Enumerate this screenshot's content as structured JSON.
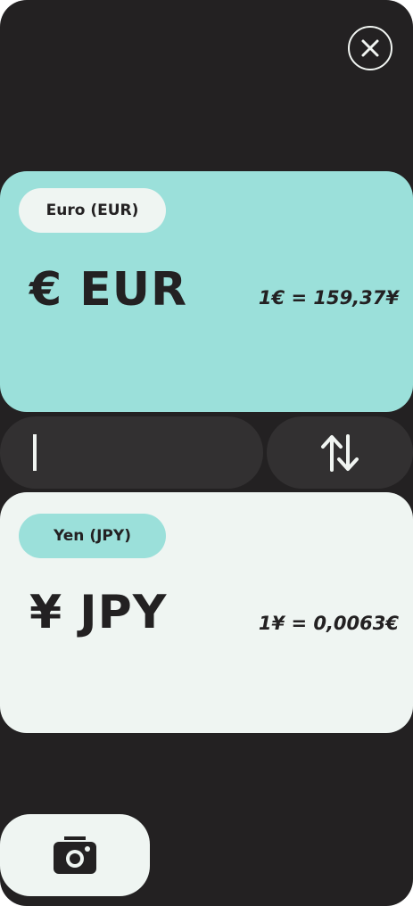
{
  "colors": {
    "background": "#232122",
    "accent": "#9be0da",
    "light": "#eff5f2",
    "field": "#323031",
    "text_dark": "#232122"
  },
  "header": {
    "close_icon": "close-icon"
  },
  "from_currency": {
    "name": "Euro (EUR)",
    "code_display": "€ EUR",
    "rate_text": "1€ =  159,37¥"
  },
  "amount_input": {
    "value": ""
  },
  "swap": {
    "icon": "swap-vertical-icon"
  },
  "to_currency": {
    "name": "Yen (JPY)",
    "code_display": "¥ JPY",
    "rate_text": "1¥ =  0,0063€"
  },
  "camera": {
    "icon": "camera-icon"
  }
}
